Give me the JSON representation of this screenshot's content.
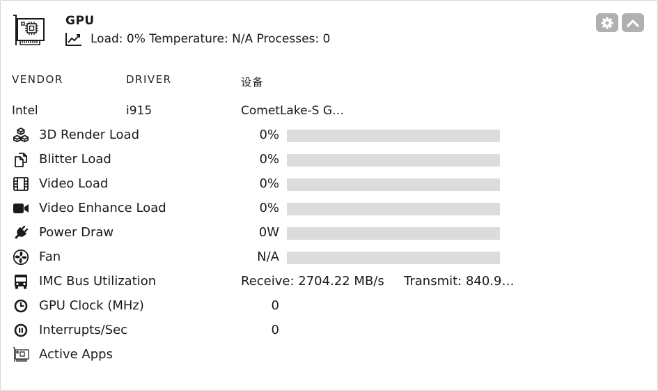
{
  "header": {
    "title": "GPU",
    "subtitle": "Load: 0% Temperature: N/A Processes: 0",
    "settings_icon": "gear-icon",
    "collapse_icon": "chevron-up-icon"
  },
  "columns": {
    "vendor": "VENDOR",
    "driver": "DRIVER",
    "device": "设备"
  },
  "device": {
    "vendor": "Intel",
    "driver": "i915",
    "device": "CometLake-S G…"
  },
  "rows": [
    {
      "icon": "cubes-icon",
      "label": "3D Render Load",
      "value": "0%",
      "bar": 0
    },
    {
      "icon": "clone-icon",
      "label": "Blitter Load",
      "value": "0%",
      "bar": 0
    },
    {
      "icon": "film-icon",
      "label": "Video Load",
      "value": "0%",
      "bar": 0
    },
    {
      "icon": "video-camera-icon",
      "label": "Video Enhance Load",
      "value": "0%",
      "bar": 0
    },
    {
      "icon": "plug-icon",
      "label": "Power Draw",
      "value": "0W",
      "bar": 0
    },
    {
      "icon": "fan-icon",
      "label": "Fan",
      "value": "N/A",
      "bar": 0
    },
    {
      "icon": "bus-icon",
      "label": "IMC Bus Utilization",
      "receive": "Receive: 2704.22 MB/s",
      "transmit": "Transmit: 840.9…"
    },
    {
      "icon": "clock-icon",
      "label": "GPU Clock (MHz)",
      "value": "0"
    },
    {
      "icon": "pause-circle-icon",
      "label": "Interrupts/Sec",
      "value": "0"
    },
    {
      "icon": "gpu-card-icon",
      "label": "Active Apps"
    }
  ],
  "colors": {
    "bar_track": "#dcdcdc",
    "button_bg": "#b0b0b0"
  }
}
